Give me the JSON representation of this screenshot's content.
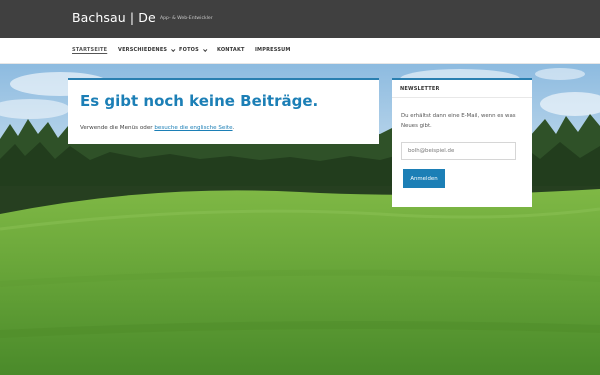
{
  "site": {
    "title": "Bachsau | De",
    "description": "App- & Web-Entwickler"
  },
  "nav": {
    "items": [
      {
        "label": "STARTSEITE",
        "active": true,
        "dropdown": false
      },
      {
        "label": "VERSCHIEDENES",
        "active": false,
        "dropdown": true
      },
      {
        "label": "FOTOS",
        "active": false,
        "dropdown": true
      },
      {
        "label": "KONTAKT",
        "active": false,
        "dropdown": false
      },
      {
        "label": "IMPRESSUM",
        "active": false,
        "dropdown": false
      }
    ]
  },
  "main": {
    "title": "Es gibt noch keine Beiträge.",
    "text_before": "Verwende die Menüs oder ",
    "link_text": "besuche die englische Seite",
    "text_after": "."
  },
  "newsletter": {
    "title": "NEWSLETTER",
    "text": "Du erhältst dann eine E-Mail, wenn es was Neues gibt.",
    "email_placeholder": "bolh@beispiel.de",
    "submit_label": "Anmelden"
  },
  "colors": {
    "topbar": "#404040",
    "accent": "#1c7fb6",
    "sky": "#9ec7e6",
    "forest": "#2b4a25",
    "meadow": "#6aa73a"
  }
}
